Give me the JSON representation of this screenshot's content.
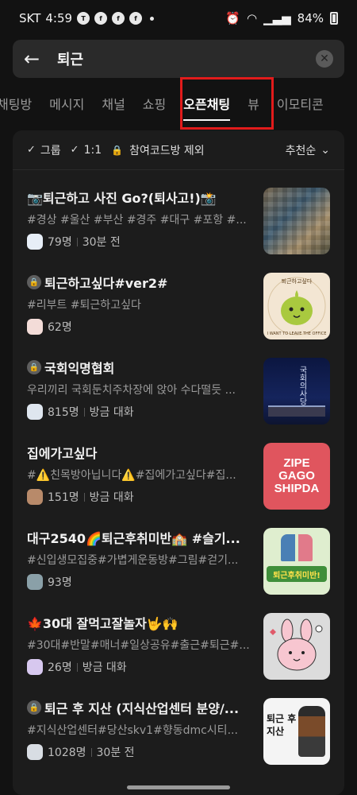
{
  "status": {
    "carrier": "SKT",
    "time": "4:59",
    "battery": "84%"
  },
  "search": {
    "query": "퇴근"
  },
  "tabs": [
    "채팅방",
    "메시지",
    "채널",
    "쇼핑",
    "오픈채팅",
    "뷰",
    "이모티콘"
  ],
  "filters": {
    "group": "그룹",
    "one_to_one": "1:1",
    "exclude": "참여코드방 제외",
    "sort": "추천순"
  },
  "items": [
    {
      "title": "📷퇴근하고 사진 Go?(퇴사고!)📸",
      "tags": "#경상 #울산 #부산 #경주 #대구 #포항 #...",
      "count": "79명",
      "time": "30분 전"
    },
    {
      "title": "퇴근하고싶다#ver2#",
      "tags": "#리부트 #퇴근하고싶다",
      "count": "62명",
      "time": ""
    },
    {
      "title": "국회익명협회",
      "tags": "우리끼리 국회둔치주차장에 앉아 수다떨듯 ...",
      "count": "815명",
      "time": "방금 대화"
    },
    {
      "title": "집에가고싶다",
      "tags": "#⚠️친목방아닙니다⚠️#집에가고싶다#집...",
      "count": "151명",
      "time": "방금 대화"
    },
    {
      "title": "대구2540🌈퇴근후취미반🏫 #슬기...",
      "tags": "#신입생모집중#가볍게운동방#그림#걷기...",
      "count": "93명",
      "time": ""
    },
    {
      "title": "🍁30대 잘먹고잘놀자🤟🙌",
      "tags": "#30대#반말#매너#일상공유#출근#퇴근#...",
      "count": "26명",
      "time": "방금 대화"
    },
    {
      "title": "퇴근 후 지산 (지식산업센터 분양/...",
      "tags": "#지식산업센터#당산skv1#향동dmc시티...",
      "count": "1028명",
      "time": "30분 전"
    }
  ],
  "thumb_texts": {
    "t2_top": "퇴근하고싶다",
    "t2_bottom": "I WANT TO LEAVE THE OFFICE",
    "t3": "국회의사당",
    "t4_line1": "ZIPE",
    "t4_line2": "GAGO",
    "t4_line3": "SHIPDA",
    "t5": "퇴근후취미반!",
    "t7": "퇴근 후 지산"
  },
  "colors": {
    "highlight": "#e11b1b",
    "background": "#121212",
    "panel": "#1c1c1c"
  }
}
